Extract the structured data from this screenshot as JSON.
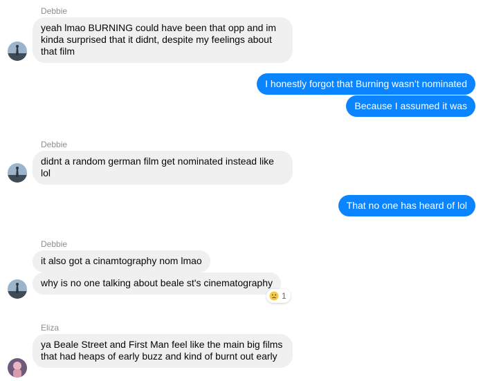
{
  "messages": [
    {
      "sender": "Debbie",
      "text": "yeah lmao BURNING could have been that opp and im kinda surprised that it didnt, despite my feelings about that film"
    },
    {
      "text": "I honestly forgot that Burning wasn’t nominated"
    },
    {
      "text": "Because I assumed it was"
    },
    {
      "sender": "Debbie",
      "text": "didnt a random german film get nominated instead like lol"
    },
    {
      "text": "That no one has heard of lol"
    },
    {
      "sender": "Debbie",
      "text": "it also got a cinamtography nom lmao"
    },
    {
      "text": "why is no one talking about beale st's cinematography"
    },
    {
      "sender": "Eliza",
      "text": "ya Beale Street and First Man feel like the main big films that had heaps of early buzz and kind of burnt out early"
    }
  ],
  "reaction": {
    "icon": "sad-face-emoji-icon",
    "count": "1"
  },
  "colors": {
    "outgoing": "#0a84ff",
    "incoming": "#f0f0f0",
    "sender_name": "#8a8d91"
  }
}
